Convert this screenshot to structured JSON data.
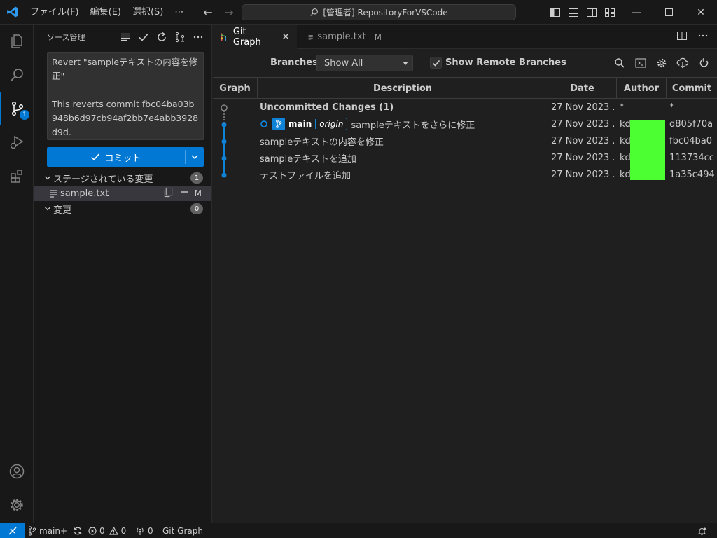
{
  "titlebar": {
    "menu": [
      "ファイル(F)",
      "編集(E)",
      "選択(S)",
      "⋯"
    ],
    "search_text": "[管理者] RepositoryForVSCode"
  },
  "activity": {
    "scm_badge": "1"
  },
  "sidebar": {
    "title": "ソース管理",
    "commit_message": "Revert \"sampleテキストの内容を修正\"\n\nThis reverts commit fbc04ba03b948b6d97cb94af2bb7e4abb3928d9d.",
    "commit_button_label": "コミット",
    "staged": {
      "label": "ステージされている変更",
      "count": "1"
    },
    "staged_file": {
      "name": "sample.txt",
      "status": "M"
    },
    "changes": {
      "label": "変更",
      "count": "0"
    }
  },
  "tabs": [
    {
      "label": "Git Graph"
    },
    {
      "label": "sample.txt",
      "status": "M"
    }
  ],
  "git_graph": {
    "branches_label": "Branches:",
    "branches_value": "Show All",
    "show_remote_label": "Show Remote Branches",
    "show_remote_checked": true,
    "columns": [
      "Graph",
      "Description",
      "Date",
      "Author",
      "Commit"
    ],
    "rows": [
      {
        "description": "Uncommitted Changes (1)",
        "date": "27 Nov 2023 ...",
        "author": "*",
        "commit": "*",
        "bold": true,
        "refs": []
      },
      {
        "description": "sampleテキストをさらに修正",
        "date": "27 Nov 2023 ...",
        "author": "kd",
        "commit": "d805f70a",
        "bold": false,
        "refs": [
          {
            "branch": "main",
            "remote": "origin"
          }
        ]
      },
      {
        "description": "sampleテキストの内容を修正",
        "date": "27 Nov 2023 ...",
        "author": "kd",
        "commit": "fbc04ba0",
        "bold": false,
        "refs": []
      },
      {
        "description": "sampleテキストを追加",
        "date": "27 Nov 2023 ...",
        "author": "kd",
        "commit": "113734cc",
        "bold": false,
        "refs": []
      },
      {
        "description": "テストファイルを追加",
        "date": "27 Nov 2023 ...",
        "author": "kd",
        "commit": "1a35c494",
        "bold": false,
        "refs": []
      }
    ]
  },
  "statusbar": {
    "branch": "main+",
    "errors": "0",
    "warnings": "0",
    "ports": "0",
    "git_graph": "Git Graph"
  },
  "colors": {
    "accent": "#0078d4",
    "graph_line": "#0e83d8",
    "redaction": "#4cff33"
  },
  "icons": [
    "vscode-logo-icon",
    "search-icon",
    "explorer-icon",
    "source-control-icon",
    "run-debug-icon",
    "extensions-icon",
    "account-icon",
    "manage-gear-icon",
    "check-icon",
    "refresh-icon",
    "more-icon",
    "git-graph-icon",
    "file-icon",
    "split-editor-icon",
    "terminal-icon",
    "settings-icon",
    "fetch-icon",
    "branch-icon",
    "sync-icon",
    "error-icon",
    "warning-icon",
    "ports-icon",
    "bell-icon"
  ]
}
